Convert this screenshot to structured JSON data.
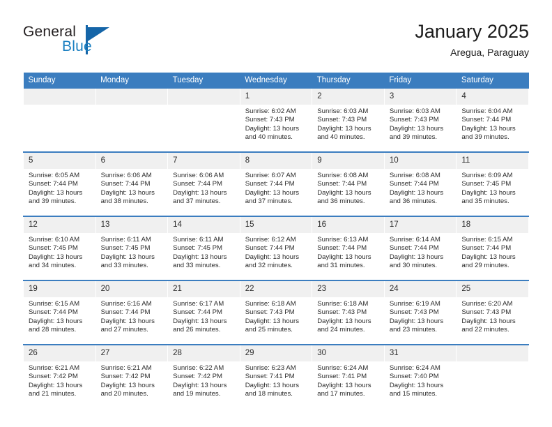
{
  "brand": {
    "name_part1": "General",
    "name_part2": "Blue",
    "logo_icon": "triangle-logo-icon",
    "accent_color": "#1565a8",
    "blue_text_color": "#1a7fc1"
  },
  "header": {
    "title": "January 2025",
    "subtitle": "Aregua, Paraguay"
  },
  "theme": {
    "header_row_bg": "#3b7dbf",
    "header_row_text": "#ffffff",
    "daynum_bg": "#f0f0f0",
    "cell_bg": "#ffffff",
    "week_separator": "#3b7dbf"
  },
  "weekdays": [
    "Sunday",
    "Monday",
    "Tuesday",
    "Wednesday",
    "Thursday",
    "Friday",
    "Saturday"
  ],
  "labels": {
    "sunrise_prefix": "Sunrise:",
    "sunset_prefix": "Sunset:",
    "daylight_prefix": "Daylight:"
  },
  "weeks": [
    [
      {
        "day": "",
        "empty": true,
        "sunrise": "",
        "sunset": "",
        "daylight_line1": "",
        "daylight_line2": ""
      },
      {
        "day": "",
        "empty": true,
        "sunrise": "",
        "sunset": "",
        "daylight_line1": "",
        "daylight_line2": ""
      },
      {
        "day": "",
        "empty": true,
        "sunrise": "",
        "sunset": "",
        "daylight_line1": "",
        "daylight_line2": ""
      },
      {
        "day": "1",
        "empty": false,
        "sunrise": "Sunrise: 6:02 AM",
        "sunset": "Sunset: 7:43 PM",
        "daylight_line1": "Daylight: 13 hours",
        "daylight_line2": "and 40 minutes."
      },
      {
        "day": "2",
        "empty": false,
        "sunrise": "Sunrise: 6:03 AM",
        "sunset": "Sunset: 7:43 PM",
        "daylight_line1": "Daylight: 13 hours",
        "daylight_line2": "and 40 minutes."
      },
      {
        "day": "3",
        "empty": false,
        "sunrise": "Sunrise: 6:03 AM",
        "sunset": "Sunset: 7:43 PM",
        "daylight_line1": "Daylight: 13 hours",
        "daylight_line2": "and 39 minutes."
      },
      {
        "day": "4",
        "empty": false,
        "sunrise": "Sunrise: 6:04 AM",
        "sunset": "Sunset: 7:44 PM",
        "daylight_line1": "Daylight: 13 hours",
        "daylight_line2": "and 39 minutes."
      }
    ],
    [
      {
        "day": "5",
        "empty": false,
        "sunrise": "Sunrise: 6:05 AM",
        "sunset": "Sunset: 7:44 PM",
        "daylight_line1": "Daylight: 13 hours",
        "daylight_line2": "and 39 minutes."
      },
      {
        "day": "6",
        "empty": false,
        "sunrise": "Sunrise: 6:06 AM",
        "sunset": "Sunset: 7:44 PM",
        "daylight_line1": "Daylight: 13 hours",
        "daylight_line2": "and 38 minutes."
      },
      {
        "day": "7",
        "empty": false,
        "sunrise": "Sunrise: 6:06 AM",
        "sunset": "Sunset: 7:44 PM",
        "daylight_line1": "Daylight: 13 hours",
        "daylight_line2": "and 37 minutes."
      },
      {
        "day": "8",
        "empty": false,
        "sunrise": "Sunrise: 6:07 AM",
        "sunset": "Sunset: 7:44 PM",
        "daylight_line1": "Daylight: 13 hours",
        "daylight_line2": "and 37 minutes."
      },
      {
        "day": "9",
        "empty": false,
        "sunrise": "Sunrise: 6:08 AM",
        "sunset": "Sunset: 7:44 PM",
        "daylight_line1": "Daylight: 13 hours",
        "daylight_line2": "and 36 minutes."
      },
      {
        "day": "10",
        "empty": false,
        "sunrise": "Sunrise: 6:08 AM",
        "sunset": "Sunset: 7:44 PM",
        "daylight_line1": "Daylight: 13 hours",
        "daylight_line2": "and 36 minutes."
      },
      {
        "day": "11",
        "empty": false,
        "sunrise": "Sunrise: 6:09 AM",
        "sunset": "Sunset: 7:45 PM",
        "daylight_line1": "Daylight: 13 hours",
        "daylight_line2": "and 35 minutes."
      }
    ],
    [
      {
        "day": "12",
        "empty": false,
        "sunrise": "Sunrise: 6:10 AM",
        "sunset": "Sunset: 7:45 PM",
        "daylight_line1": "Daylight: 13 hours",
        "daylight_line2": "and 34 minutes."
      },
      {
        "day": "13",
        "empty": false,
        "sunrise": "Sunrise: 6:11 AM",
        "sunset": "Sunset: 7:45 PM",
        "daylight_line1": "Daylight: 13 hours",
        "daylight_line2": "and 33 minutes."
      },
      {
        "day": "14",
        "empty": false,
        "sunrise": "Sunrise: 6:11 AM",
        "sunset": "Sunset: 7:45 PM",
        "daylight_line1": "Daylight: 13 hours",
        "daylight_line2": "and 33 minutes."
      },
      {
        "day": "15",
        "empty": false,
        "sunrise": "Sunrise: 6:12 AM",
        "sunset": "Sunset: 7:44 PM",
        "daylight_line1": "Daylight: 13 hours",
        "daylight_line2": "and 32 minutes."
      },
      {
        "day": "16",
        "empty": false,
        "sunrise": "Sunrise: 6:13 AM",
        "sunset": "Sunset: 7:44 PM",
        "daylight_line1": "Daylight: 13 hours",
        "daylight_line2": "and 31 minutes."
      },
      {
        "day": "17",
        "empty": false,
        "sunrise": "Sunrise: 6:14 AM",
        "sunset": "Sunset: 7:44 PM",
        "daylight_line1": "Daylight: 13 hours",
        "daylight_line2": "and 30 minutes."
      },
      {
        "day": "18",
        "empty": false,
        "sunrise": "Sunrise: 6:15 AM",
        "sunset": "Sunset: 7:44 PM",
        "daylight_line1": "Daylight: 13 hours",
        "daylight_line2": "and 29 minutes."
      }
    ],
    [
      {
        "day": "19",
        "empty": false,
        "sunrise": "Sunrise: 6:15 AM",
        "sunset": "Sunset: 7:44 PM",
        "daylight_line1": "Daylight: 13 hours",
        "daylight_line2": "and 28 minutes."
      },
      {
        "day": "20",
        "empty": false,
        "sunrise": "Sunrise: 6:16 AM",
        "sunset": "Sunset: 7:44 PM",
        "daylight_line1": "Daylight: 13 hours",
        "daylight_line2": "and 27 minutes."
      },
      {
        "day": "21",
        "empty": false,
        "sunrise": "Sunrise: 6:17 AM",
        "sunset": "Sunset: 7:44 PM",
        "daylight_line1": "Daylight: 13 hours",
        "daylight_line2": "and 26 minutes."
      },
      {
        "day": "22",
        "empty": false,
        "sunrise": "Sunrise: 6:18 AM",
        "sunset": "Sunset: 7:43 PM",
        "daylight_line1": "Daylight: 13 hours",
        "daylight_line2": "and 25 minutes."
      },
      {
        "day": "23",
        "empty": false,
        "sunrise": "Sunrise: 6:18 AM",
        "sunset": "Sunset: 7:43 PM",
        "daylight_line1": "Daylight: 13 hours",
        "daylight_line2": "and 24 minutes."
      },
      {
        "day": "24",
        "empty": false,
        "sunrise": "Sunrise: 6:19 AM",
        "sunset": "Sunset: 7:43 PM",
        "daylight_line1": "Daylight: 13 hours",
        "daylight_line2": "and 23 minutes."
      },
      {
        "day": "25",
        "empty": false,
        "sunrise": "Sunrise: 6:20 AM",
        "sunset": "Sunset: 7:43 PM",
        "daylight_line1": "Daylight: 13 hours",
        "daylight_line2": "and 22 minutes."
      }
    ],
    [
      {
        "day": "26",
        "empty": false,
        "sunrise": "Sunrise: 6:21 AM",
        "sunset": "Sunset: 7:42 PM",
        "daylight_line1": "Daylight: 13 hours",
        "daylight_line2": "and 21 minutes."
      },
      {
        "day": "27",
        "empty": false,
        "sunrise": "Sunrise: 6:21 AM",
        "sunset": "Sunset: 7:42 PM",
        "daylight_line1": "Daylight: 13 hours",
        "daylight_line2": "and 20 minutes."
      },
      {
        "day": "28",
        "empty": false,
        "sunrise": "Sunrise: 6:22 AM",
        "sunset": "Sunset: 7:42 PM",
        "daylight_line1": "Daylight: 13 hours",
        "daylight_line2": "and 19 minutes."
      },
      {
        "day": "29",
        "empty": false,
        "sunrise": "Sunrise: 6:23 AM",
        "sunset": "Sunset: 7:41 PM",
        "daylight_line1": "Daylight: 13 hours",
        "daylight_line2": "and 18 minutes."
      },
      {
        "day": "30",
        "empty": false,
        "sunrise": "Sunrise: 6:24 AM",
        "sunset": "Sunset: 7:41 PM",
        "daylight_line1": "Daylight: 13 hours",
        "daylight_line2": "and 17 minutes."
      },
      {
        "day": "31",
        "empty": false,
        "sunrise": "Sunrise: 6:24 AM",
        "sunset": "Sunset: 7:40 PM",
        "daylight_line1": "Daylight: 13 hours",
        "daylight_line2": "and 15 minutes."
      },
      {
        "day": "",
        "empty": true,
        "sunrise": "",
        "sunset": "",
        "daylight_line1": "",
        "daylight_line2": ""
      }
    ]
  ]
}
